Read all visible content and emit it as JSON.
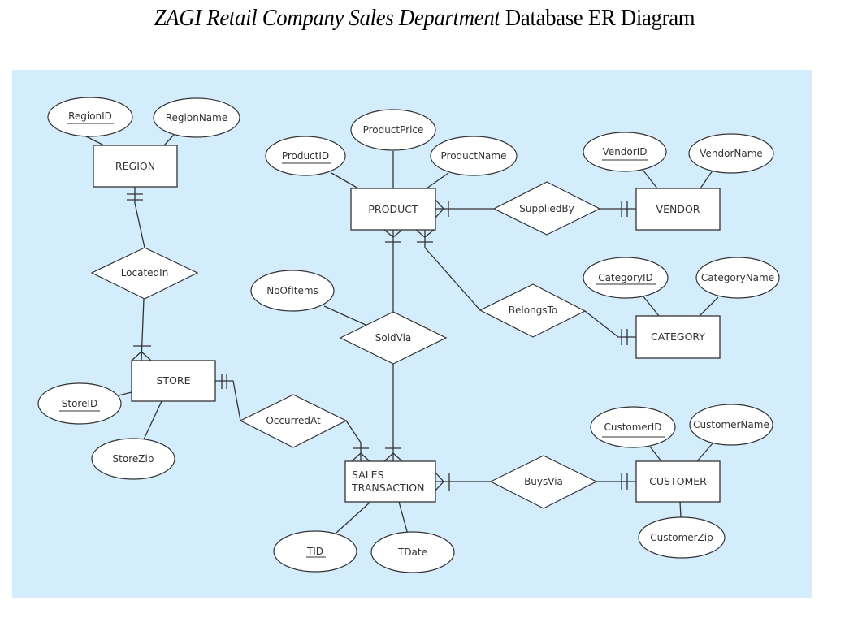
{
  "title": {
    "italic_part": "ZAGI Retail Company Sales Department",
    "regular_part": "Database ER Diagram"
  },
  "colors": {
    "panel_background": "#d4edfc",
    "shape_fill": "#ffffff",
    "stroke": "#333333"
  },
  "entities": {
    "region": "REGION",
    "store": "STORE",
    "product": "PRODUCT",
    "vendor": "VENDOR",
    "category": "CATEGORY",
    "sales_transaction_line1": "SALES",
    "sales_transaction_line2": "TRANSACTION",
    "customer": "CUSTOMER"
  },
  "relationships": {
    "located_in": "LocatedIn",
    "supplied_by": "SuppliedBy",
    "belongs_to": "BelongsTo",
    "sold_via": "SoldVia",
    "occurred_at": "OccurredAt",
    "buys_via": "BuysVia"
  },
  "attributes": {
    "region_id": {
      "label": "RegionID",
      "key": true
    },
    "region_name": {
      "label": "RegionName",
      "key": false
    },
    "product_id": {
      "label": "ProductID",
      "key": true
    },
    "product_price": {
      "label": "ProductPrice",
      "key": false
    },
    "product_name": {
      "label": "ProductName",
      "key": false
    },
    "vendor_id": {
      "label": "VendorID",
      "key": true
    },
    "vendor_name": {
      "label": "VendorName",
      "key": false
    },
    "category_id": {
      "label": "CategoryID",
      "key": true
    },
    "category_name": {
      "label": "CategoryName",
      "key": false
    },
    "no_of_items": {
      "label": "NoOfItems",
      "key": false
    },
    "store_id": {
      "label": "StoreID",
      "key": true
    },
    "store_zip": {
      "label": "StoreZip",
      "key": false
    },
    "customer_id": {
      "label": "CustomerID",
      "key": true
    },
    "customer_name": {
      "label": "CustomerName",
      "key": false
    },
    "customer_zip": {
      "label": "CustomerZip",
      "key": false
    },
    "tid": {
      "label": "TID",
      "key": true
    },
    "tdate": {
      "label": "TDate",
      "key": false
    }
  },
  "cardinalities": [
    {
      "relationship": "LocatedIn",
      "entity": "REGION",
      "notation": "mandatory-one"
    },
    {
      "relationship": "LocatedIn",
      "entity": "STORE",
      "notation": "mandatory-many"
    },
    {
      "relationship": "SuppliedBy",
      "entity": "PRODUCT",
      "notation": "mandatory-many"
    },
    {
      "relationship": "SuppliedBy",
      "entity": "VENDOR",
      "notation": "mandatory-one"
    },
    {
      "relationship": "BelongsTo",
      "entity": "PRODUCT",
      "notation": "mandatory-many"
    },
    {
      "relationship": "BelongsTo",
      "entity": "CATEGORY",
      "notation": "mandatory-one"
    },
    {
      "relationship": "SoldVia",
      "entity": "PRODUCT",
      "notation": "mandatory-many"
    },
    {
      "relationship": "SoldVia",
      "entity": "SALES TRANSACTION",
      "notation": "mandatory-many"
    },
    {
      "relationship": "OccurredAt",
      "entity": "STORE",
      "notation": "mandatory-one"
    },
    {
      "relationship": "OccurredAt",
      "entity": "SALES TRANSACTION",
      "notation": "mandatory-many"
    },
    {
      "relationship": "BuysVia",
      "entity": "SALES TRANSACTION",
      "notation": "mandatory-many"
    },
    {
      "relationship": "BuysVia",
      "entity": "CUSTOMER",
      "notation": "mandatory-one"
    }
  ]
}
